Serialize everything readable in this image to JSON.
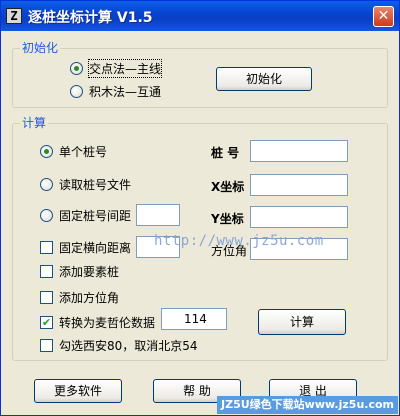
{
  "window": {
    "title": "逐桩坐标计算 V1.5",
    "icon_glyph": "Z",
    "close_glyph": "✕"
  },
  "init_group": {
    "legend": "初始化",
    "options": [
      "交点法—主线",
      "积木法—互通"
    ],
    "selected_index": 0,
    "button": "初始化"
  },
  "calc_group": {
    "legend": "计算",
    "radio_options": [
      "单个桩号",
      "读取桩号文件",
      "固定桩号间距"
    ],
    "selected_index": 0,
    "checkboxes": [
      {
        "label": "固定横向距离",
        "checked": false
      },
      {
        "label": "添加要素桩",
        "checked": false
      },
      {
        "label": "添加方位角",
        "checked": false
      },
      {
        "label": "转换为麦哲伦数据",
        "checked": true
      },
      {
        "label": "勾选西安80，取消北京54",
        "checked": false
      }
    ],
    "fields": {
      "station_label": "桩 号",
      "x_label": "X坐标",
      "y_label": "Y坐标",
      "azimuth_label": "方位角"
    },
    "magellan_value": "114",
    "calc_button": "计算"
  },
  "bottom_buttons": {
    "more": "更多软件",
    "help": "帮  助",
    "exit": "退  出"
  },
  "watermark": "http://www.jz5u.com",
  "brand": "JZ5U绿色下载站www.jz5u.com"
}
